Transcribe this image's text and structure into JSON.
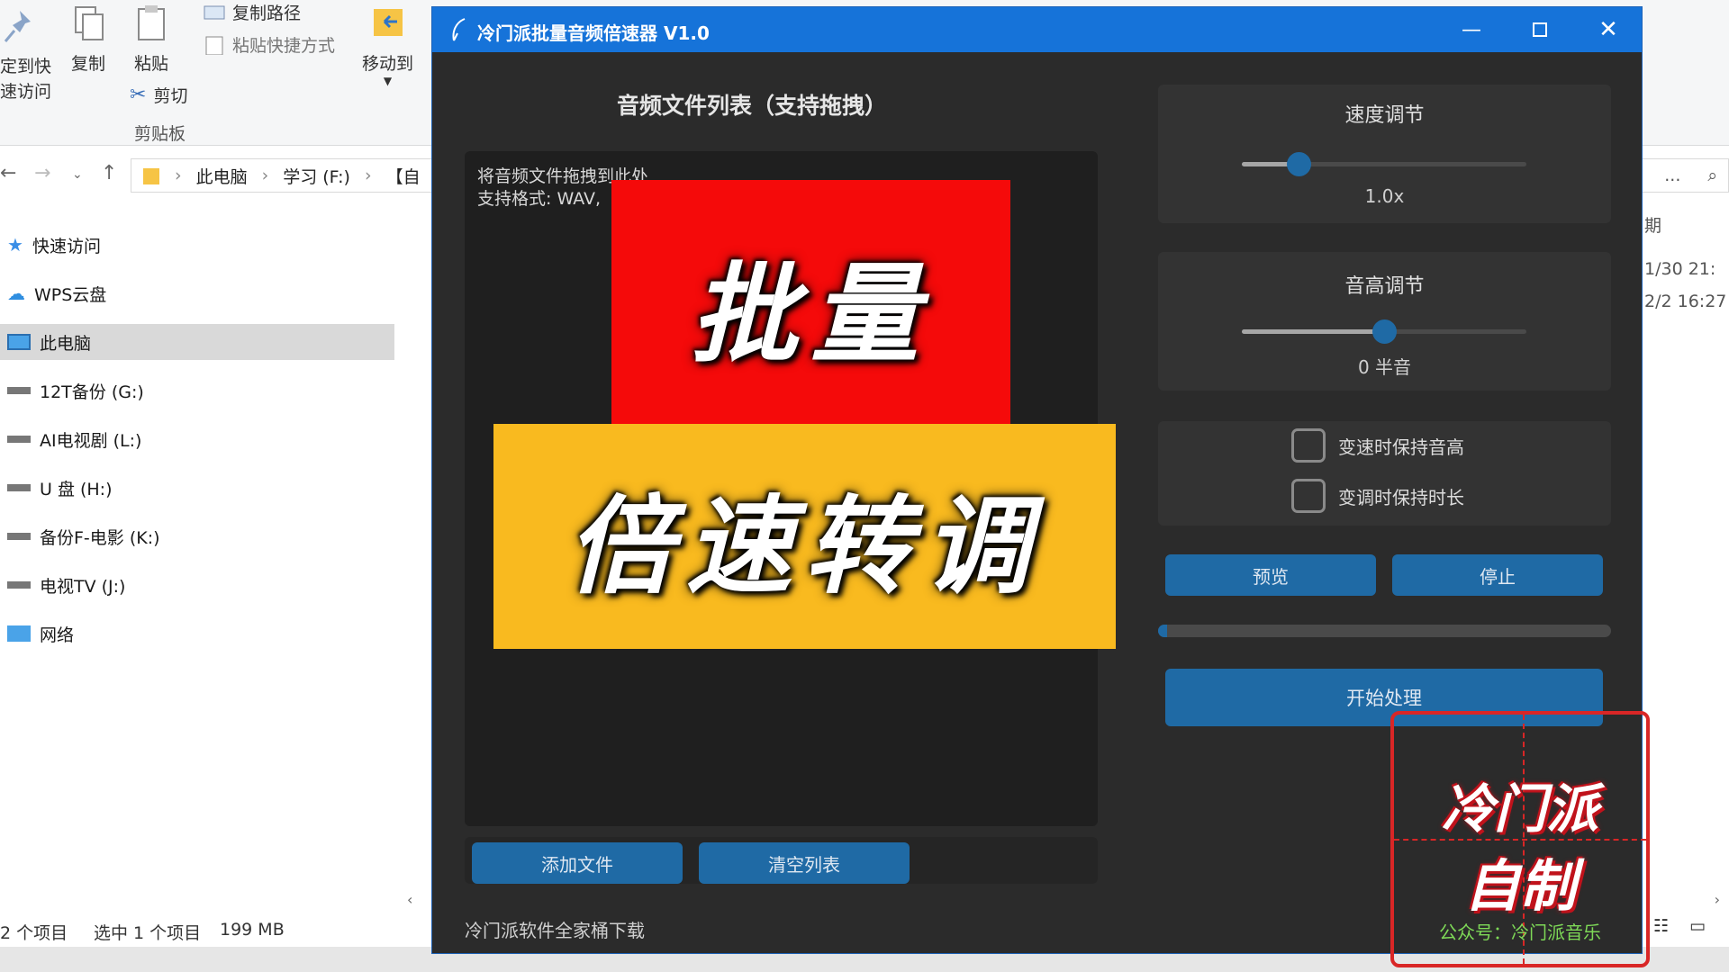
{
  "explorer": {
    "ribbon": {
      "pin": "定到快\n速访问",
      "copy": "复制",
      "paste": "粘贴",
      "copy_path": "复制路径",
      "paste_shortcut": "粘贴快捷方式",
      "cut": "剪切",
      "clipboard_group": "剪贴板",
      "move_to": "移动到"
    },
    "breadcrumb": [
      "此电脑",
      "学习 (F:)",
      "【自"
    ],
    "sidebar": [
      "快速访问",
      "WPS云盘",
      "此电脑",
      "12T备份 (G:)",
      "AI电视剧 (L:)",
      "U 盘 (H:)",
      "备份F-电影 (K:)",
      "电视TV (J:)",
      "网络"
    ],
    "right_column": [
      "期",
      "1/30 21:",
      "2/2 16:27"
    ],
    "status": {
      "items": "2 个项目",
      "selected": "选中 1 个项目",
      "size": "199 MB"
    }
  },
  "app": {
    "title": "冷门派批量音频倍速器 V1.0",
    "list_title": "音频文件列表（支持拖拽）",
    "drop_hint_line1": "将音频文件拖拽到此处",
    "drop_hint_line2": "支持格式: WAV,",
    "add_files": "添加文件",
    "clear_list": "清空列表",
    "footer": "冷门派软件全家桶下载",
    "speed": {
      "title": "速度调节",
      "value_label": "1.0x",
      "position": 0.2
    },
    "pitch": {
      "title": "音高调节",
      "value_label": "0 半音",
      "position": 0.5
    },
    "checkboxes": [
      {
        "label": "变速时保持音高",
        "checked": false
      },
      {
        "label": "变调时保持时长",
        "checked": false
      }
    ],
    "preview": "预览",
    "stop": "停止",
    "progress": 0.02,
    "start": "开始处理",
    "accent_color": "#1f6aa5",
    "titlebar_color": "#1673d9"
  },
  "overlay": {
    "banner_top": "批量",
    "banner_bottom": "倍速转调",
    "stamp_line1": "冷门派",
    "stamp_line2": "自制",
    "stamp_sub": "公众号：冷门派音乐"
  }
}
